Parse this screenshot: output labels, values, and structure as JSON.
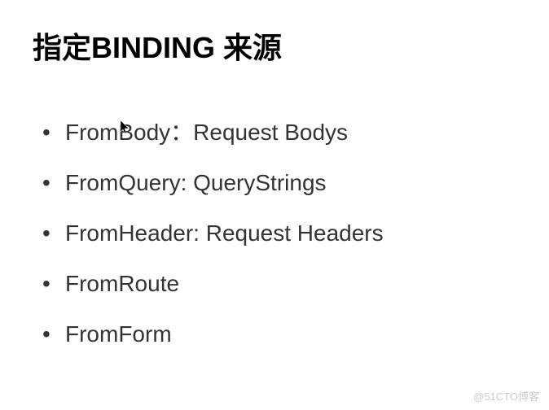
{
  "title": "指定BINDING 来源",
  "items": [
    "FromBody：Request Bodys",
    "FromQuery:  QueryStrings",
    "FromHeader:  Request Headers",
    "FromRoute",
    "FromForm"
  ],
  "watermark": "@51CTO博客"
}
